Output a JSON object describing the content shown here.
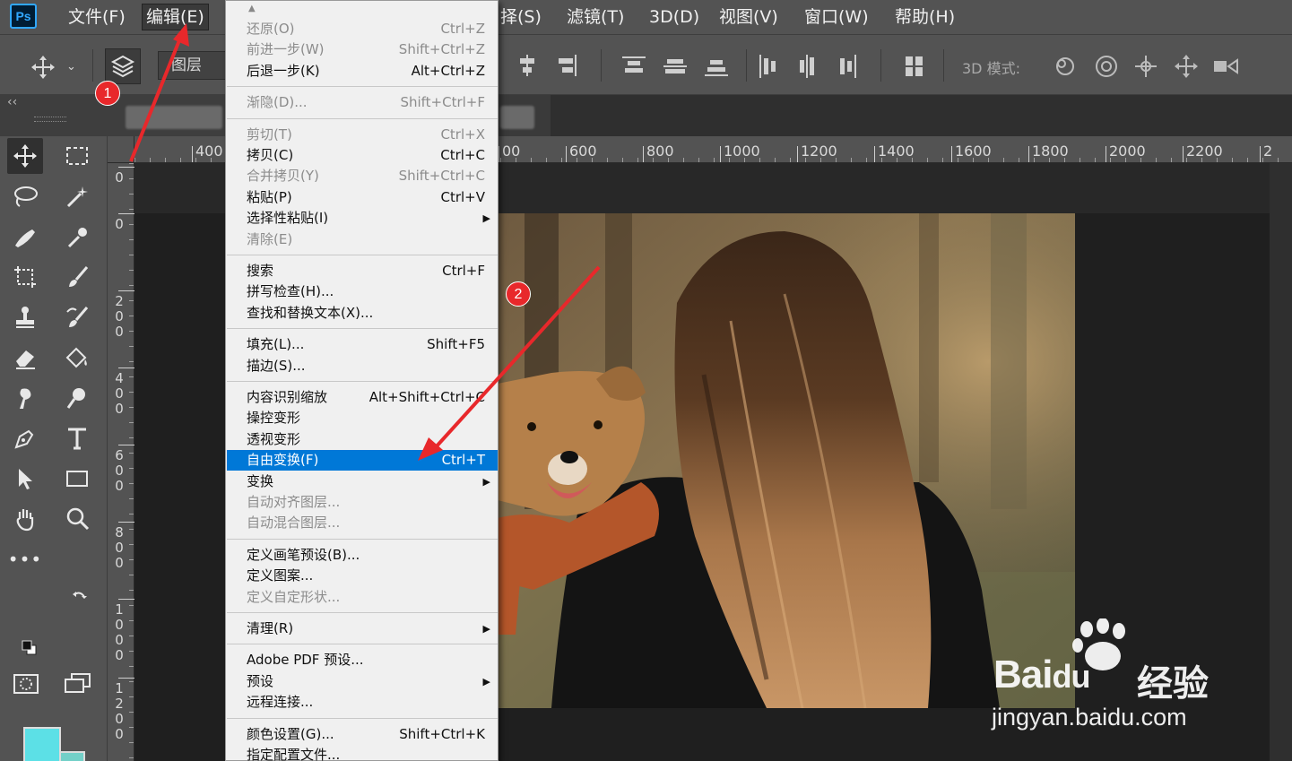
{
  "app": {
    "logo": "Ps"
  },
  "menubar": {
    "items": [
      {
        "label": "文件(F)"
      },
      {
        "label": "编辑(E)"
      },
      {
        "label": "择(S)"
      },
      {
        "label": "滤镜(T)"
      },
      {
        "label": "3D(D)"
      },
      {
        "label": "视图(V)"
      },
      {
        "label": "窗口(W)"
      },
      {
        "label": "帮助(H)"
      }
    ]
  },
  "optionsbar": {
    "layer_select": "图层",
    "mode_label": "3D 模式:",
    "icons": [
      "move-icon",
      "layers-icon",
      "align-icon",
      "distribute-icon",
      "3d-orbit-icon",
      "3d-roll-icon",
      "3d-pan-icon",
      "3d-slide-icon",
      "3d-scale-icon"
    ]
  },
  "tabstrip": {
    "collapse": "‹‹"
  },
  "ruler": {
    "x_labels": [
      "400",
      "00",
      "600",
      "800",
      "1000",
      "1200",
      "1400",
      "1600",
      "1800",
      "2000",
      "2200",
      "2"
    ],
    "y_labels": [
      "0",
      "0",
      "2\n0\n0",
      "4\n0\n0",
      "6\n0\n0",
      "8\n0\n0",
      "1\n0\n0\n0",
      "1\n2\n0\n0"
    ]
  },
  "toolbox": {
    "tools": [
      "move-tool",
      "marquee-tool",
      "lasso-tool",
      "magic-wand-tool",
      "brush-heal-tool",
      "eyedropper-tool",
      "crop-tool",
      "brush-tool",
      "stamp-tool",
      "history-brush-tool",
      "eraser-tool",
      "paint-bucket-tool",
      "smudge-tool",
      "dodge-tool",
      "pen-tool",
      "type-tool",
      "path-select-tool",
      "rectangle-tool",
      "hand-tool",
      "zoom-tool",
      "more-tools",
      "quickmask-tool",
      "screen-mode-tool"
    ],
    "foreground_color": "#5ce0e6",
    "background_color": "#73d0c8"
  },
  "edit_menu": {
    "groups": [
      [
        {
          "label": "还原(O)",
          "shortcut": "Ctrl+Z",
          "disabled": true
        },
        {
          "label": "前进一步(W)",
          "shortcut": "Shift+Ctrl+Z",
          "disabled": true
        },
        {
          "label": "后退一步(K)",
          "shortcut": "Alt+Ctrl+Z",
          "disabled": false
        }
      ],
      [
        {
          "label": "渐隐(D)...",
          "shortcut": "Shift+Ctrl+F",
          "disabled": true
        }
      ],
      [
        {
          "label": "剪切(T)",
          "shortcut": "Ctrl+X",
          "disabled": true
        },
        {
          "label": "拷贝(C)",
          "shortcut": "Ctrl+C",
          "disabled": false
        },
        {
          "label": "合并拷贝(Y)",
          "shortcut": "Shift+Ctrl+C",
          "disabled": true
        },
        {
          "label": "粘贴(P)",
          "shortcut": "Ctrl+V",
          "disabled": false
        },
        {
          "label": "选择性粘贴(I)",
          "shortcut": "",
          "submenu": true,
          "disabled": false
        },
        {
          "label": "清除(E)",
          "shortcut": "",
          "disabled": true
        }
      ],
      [
        {
          "label": "搜索",
          "shortcut": "Ctrl+F",
          "disabled": false
        },
        {
          "label": "拼写检查(H)...",
          "shortcut": "",
          "disabled": false
        },
        {
          "label": "查找和替换文本(X)...",
          "shortcut": "",
          "disabled": false
        }
      ],
      [
        {
          "label": "填充(L)...",
          "shortcut": "Shift+F5",
          "disabled": false
        },
        {
          "label": "描边(S)...",
          "shortcut": "",
          "disabled": false
        }
      ],
      [
        {
          "label": "内容识别缩放",
          "shortcut": "Alt+Shift+Ctrl+C",
          "disabled": false
        },
        {
          "label": "操控变形",
          "shortcut": "",
          "disabled": false
        },
        {
          "label": "透视变形",
          "shortcut": "",
          "disabled": false
        },
        {
          "label": "自由变换(F)",
          "shortcut": "Ctrl+T",
          "disabled": false,
          "highlight": true
        },
        {
          "label": "变换",
          "shortcut": "",
          "submenu": true,
          "disabled": false
        },
        {
          "label": "自动对齐图层...",
          "shortcut": "",
          "disabled": true
        },
        {
          "label": "自动混合图层...",
          "shortcut": "",
          "disabled": true
        }
      ],
      [
        {
          "label": "定义画笔预设(B)...",
          "shortcut": "",
          "disabled": false
        },
        {
          "label": "定义图案...",
          "shortcut": "",
          "disabled": false
        },
        {
          "label": "定义自定形状...",
          "shortcut": "",
          "disabled": true
        }
      ],
      [
        {
          "label": "清理(R)",
          "shortcut": "",
          "submenu": true,
          "disabled": false
        }
      ],
      [
        {
          "label": "Adobe PDF 预设...",
          "shortcut": "",
          "disabled": false
        },
        {
          "label": "预设",
          "shortcut": "",
          "submenu": true,
          "disabled": false
        },
        {
          "label": "远程连接...",
          "shortcut": "",
          "disabled": false
        }
      ],
      [
        {
          "label": "颜色设置(G)...",
          "shortcut": "Shift+Ctrl+K",
          "disabled": false
        },
        {
          "label": "指定配置文件...",
          "shortcut": "",
          "disabled": false
        }
      ]
    ]
  },
  "annotations": {
    "badge1": "1",
    "badge2": "2",
    "arrow_color": "#e8282b"
  },
  "watermark": {
    "brand": "Bai",
    "brand2": "du",
    "cn": "经验",
    "url": "jingyan.baidu.com"
  }
}
